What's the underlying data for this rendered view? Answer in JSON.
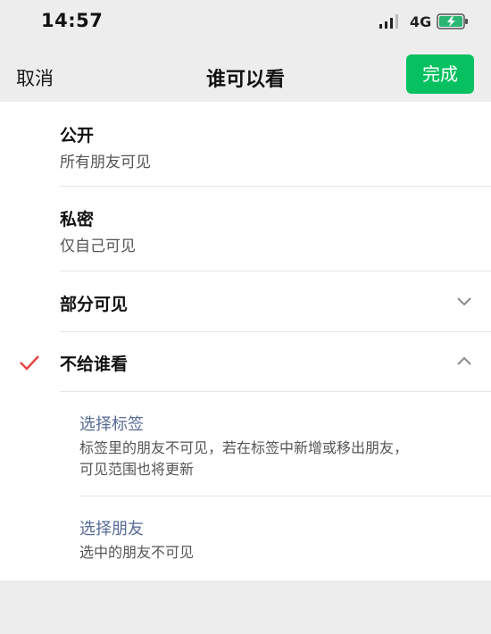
{
  "status_bar": {
    "time": "14:57",
    "network": "4G",
    "signal_icon": "signal-bars-icon",
    "battery_icon": "battery-charging-icon",
    "battery_color": "#2bb673"
  },
  "nav": {
    "cancel_label": "取消",
    "title": "谁可以看",
    "done_label": "完成",
    "done_color": "#07c160"
  },
  "options": [
    {
      "title": "公开",
      "subtitle": "所有朋友可见",
      "selected": false
    },
    {
      "title": "私密",
      "subtitle": "仅自己可见",
      "selected": false
    },
    {
      "title": "部分可见",
      "expanded": false,
      "icon": "chevron-down-icon",
      "selected": false
    },
    {
      "title": "不给谁看",
      "expanded": true,
      "icon": "chevron-up-icon",
      "selected": true,
      "check_icon": "checkmark-icon",
      "check_color": "#e64340",
      "children": [
        {
          "title": "选择标签",
          "desc_line1": "标签里的朋友不可见，若在标签中新增或移出朋友，",
          "desc_line2": "可见范围也将更新"
        },
        {
          "title": "选择朋友",
          "desc_line1": "选中的朋友不可见"
        }
      ]
    }
  ]
}
